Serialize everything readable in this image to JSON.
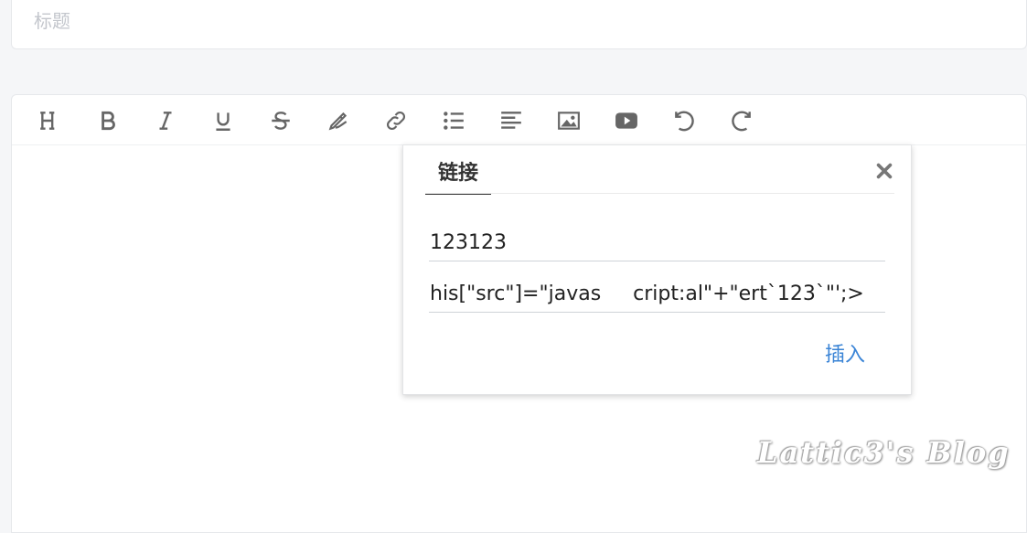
{
  "title_field": {
    "placeholder": "标题"
  },
  "toolbar": {
    "buttons": [
      {
        "icon": "heading-icon"
      },
      {
        "icon": "bold-icon"
      },
      {
        "icon": "italic-icon"
      },
      {
        "icon": "underline-icon"
      },
      {
        "icon": "strikethrough-icon"
      },
      {
        "icon": "highlight-pen-icon"
      },
      {
        "icon": "link-icon"
      },
      {
        "icon": "bullet-list-icon"
      },
      {
        "icon": "align-left-icon"
      },
      {
        "icon": "image-icon"
      },
      {
        "icon": "video-icon"
      },
      {
        "icon": "undo-icon"
      },
      {
        "icon": "redo-icon"
      }
    ],
    "icon_color": "#666666"
  },
  "link_dialog": {
    "tab_label": "链接",
    "link_text_value": "123123",
    "link_url_value": "his[\"src\"]=\"javas     cript:al\"+\"ert`123`\"';>",
    "insert_label": "插入",
    "accent_color": "#3a84d6"
  },
  "watermark": {
    "text": "Lattic3's Blog"
  }
}
